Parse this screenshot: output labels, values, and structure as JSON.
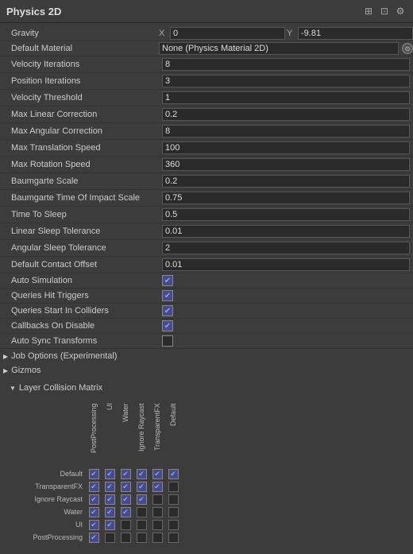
{
  "header": {
    "title": "Physics 2D",
    "icons": [
      "layers",
      "grid",
      "gear"
    ]
  },
  "gravity": {
    "label": "Gravity",
    "x_label": "X",
    "x_value": "0",
    "y_label": "Y",
    "y_value": "-9.81"
  },
  "default_material": {
    "label": "Default Material",
    "value": "None (Physics Material 2D)"
  },
  "rows": [
    {
      "label": "Velocity Iterations",
      "value": "8"
    },
    {
      "label": "Position Iterations",
      "value": "3"
    },
    {
      "label": "Velocity Threshold",
      "value": "1"
    },
    {
      "label": "Max Linear Correction",
      "value": "0.2"
    },
    {
      "label": "Max Angular Correction",
      "value": "8"
    },
    {
      "label": "Max Translation Speed",
      "value": "100"
    },
    {
      "label": "Max Rotation Speed",
      "value": "360"
    },
    {
      "label": "Baumgarte Scale",
      "value": "0.2"
    },
    {
      "label": "Baumgarte Time Of Impact Scale",
      "value": "0.75"
    },
    {
      "label": "Time To Sleep",
      "value": "0.5"
    },
    {
      "label": "Linear Sleep Tolerance",
      "value": "0.01"
    },
    {
      "label": "Angular Sleep Tolerance",
      "value": "2"
    },
    {
      "label": "Default Contact Offset",
      "value": "0.01"
    }
  ],
  "checkboxes": [
    {
      "label": "Auto Simulation",
      "checked": true
    },
    {
      "label": "Queries Hit Triggers",
      "checked": true
    },
    {
      "label": "Queries Start In Colliders",
      "checked": true
    },
    {
      "label": "Callbacks On Disable",
      "checked": true
    },
    {
      "label": "Auto Sync Transforms",
      "checked": false
    }
  ],
  "collapsible": [
    {
      "label": "Job Options (Experimental)",
      "expanded": false
    },
    {
      "label": "Gizmos",
      "expanded": false
    }
  ],
  "layer_collision": {
    "title": "Layer Collision Matrix",
    "expanded": true,
    "col_labels": [
      "PostProcessing",
      "UI",
      "Water",
      "Ignore Raycast",
      "TransparentFX",
      "Default"
    ],
    "rows": [
      {
        "label": "Default",
        "checked": [
          true,
          true,
          true,
          true,
          true,
          true
        ]
      },
      {
        "label": "TransparentFX",
        "checked": [
          true,
          true,
          true,
          true,
          true,
          false
        ]
      },
      {
        "label": "Ignore Raycast",
        "checked": [
          true,
          true,
          true,
          true,
          false,
          false
        ]
      },
      {
        "label": "Water",
        "checked": [
          true,
          true,
          true,
          false,
          false,
          false
        ]
      },
      {
        "label": "UI",
        "checked": [
          true,
          true,
          false,
          false,
          false,
          false
        ]
      },
      {
        "label": "PostProcessing",
        "checked": [
          true,
          false,
          false,
          false,
          false,
          false
        ]
      }
    ]
  }
}
